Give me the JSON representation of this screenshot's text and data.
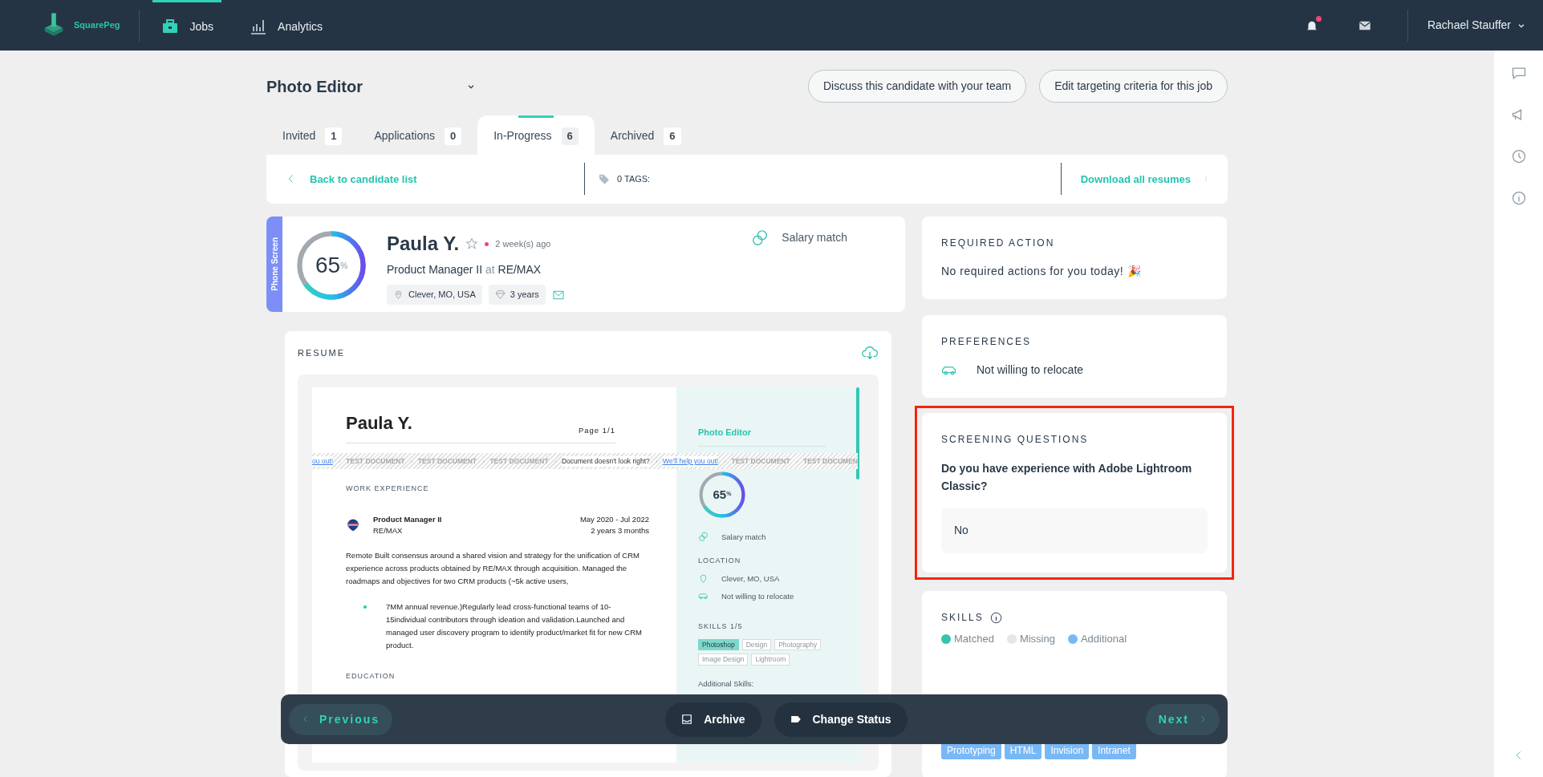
{
  "nav": {
    "logo": "SquarePeg",
    "items": [
      {
        "label": "Jobs",
        "selected": true
      },
      {
        "label": "Analytics",
        "selected": false
      }
    ],
    "unread_notifications": true,
    "user": "Rachael Stauffer"
  },
  "job": {
    "title": "Photo Editor",
    "actions": [
      "Discuss this candidate with your team",
      "Edit targeting criteria for this job"
    ]
  },
  "tabs": [
    {
      "label": "Invited",
      "count": "1",
      "selected": false
    },
    {
      "label": "Applications",
      "count": "0",
      "selected": false
    },
    {
      "label": "In-Progress",
      "count": "6",
      "selected": true
    },
    {
      "label": "Archived",
      "count": "6",
      "selected": false
    }
  ],
  "toolbar": {
    "back": "Back to candidate list",
    "tags": "0 TAGS:",
    "download": "Download all resumes"
  },
  "candidate": {
    "stage": "Phone Screen",
    "score": "65",
    "score_unit": "%",
    "level": 0.65,
    "name": "Paula Y.",
    "starred": false,
    "recently_active": true,
    "last_active": "2 week(s) ago",
    "role": "Product Manager II",
    "at": "at",
    "company": "RE/MAX",
    "location": "Clever, MO, USA",
    "experience": "3 years",
    "salary": "Salary match"
  },
  "resume": {
    "heading": "RESUME",
    "name": "Paula Y.",
    "page": "Page 1/1",
    "banner": [
      {
        "kind": "link",
        "text": "ou out!"
      },
      {
        "kind": "stamp",
        "text": "TEST DOCUMENT"
      },
      {
        "kind": "stamp",
        "text": "TEST DOCUMENT"
      },
      {
        "kind": "stamp",
        "text": "TEST DOCUMENT"
      },
      {
        "kind": "message",
        "text": "Document doesn't look right?"
      },
      {
        "kind": "link",
        "text": "We'll help you out!"
      },
      {
        "kind": "stamp",
        "text": "TEST DOCUMENT"
      },
      {
        "kind": "stamp",
        "text": "TEST DOCUMEN"
      }
    ],
    "work_heading": "WORK EXPERIENCE",
    "job": {
      "title": "Product Manager II",
      "company": "RE/MAX",
      "dates": "May 2020 - Jul 2022",
      "duration": "2 years 3 months"
    },
    "summary": "Remote Built consensus around a shared vision and strategy for the unification of CRM experience across products obtained by RE/MAX through acquisition. Managed the roadmaps and objectives for two CRM products (~5k active users,",
    "bullets": [
      "7MM annual revenue.)Regularly lead cross-functional teams of 10-15individual contributors through ideation and validation.Launched and managed user discovery program to identify product/market fit for new CRM product."
    ],
    "education_heading": "EDUCATION",
    "side": {
      "job_title": "Photo Editor",
      "score": "65",
      "score_unit": "%",
      "level": 0.65,
      "salary": "Salary match",
      "location_heading": "LOCATION",
      "location": "Clever, MO, USA",
      "relocation": "Not willing to relocate",
      "skills_heading": "SKILLS 1/5",
      "skills": [
        {
          "label": "Photoshop",
          "matched": true
        },
        {
          "label": "Design",
          "matched": false
        },
        {
          "label": "Photography",
          "matched": false
        },
        {
          "label": "Image Design",
          "matched": false
        },
        {
          "label": "Lightroom",
          "matched": false
        }
      ],
      "additional_heading": "Additional Skills:"
    }
  },
  "required_action": {
    "heading": "REQUIRED ACTION",
    "text": "No required actions for you today! 🎉"
  },
  "preferences": {
    "heading": "PREFERENCES",
    "items": [
      "Not willing to relocate"
    ]
  },
  "screening": {
    "heading": "SCREENING QUESTIONS",
    "highlighted": true,
    "questions": [
      {
        "question": "Do you have experience with Adobe Lightroom Classic?",
        "answer": "No"
      }
    ]
  },
  "skills": {
    "heading": "SKILLS",
    "legend": [
      {
        "label": "Matched",
        "color": "#36c3ad"
      },
      {
        "label": "Missing",
        "color": "#e4e7e7"
      },
      {
        "label": "Additional",
        "color": "#79b8f6"
      }
    ],
    "tags": [
      {
        "label": "Prototyping",
        "kind": "additional"
      },
      {
        "label": "HTML",
        "kind": "additional"
      },
      {
        "label": "Invision",
        "kind": "additional"
      },
      {
        "label": "Intranet",
        "kind": "additional"
      }
    ]
  },
  "bottom_bar": {
    "previous": "Previous",
    "archive": "Archive",
    "change_status": "Change Status",
    "next": "Next"
  }
}
